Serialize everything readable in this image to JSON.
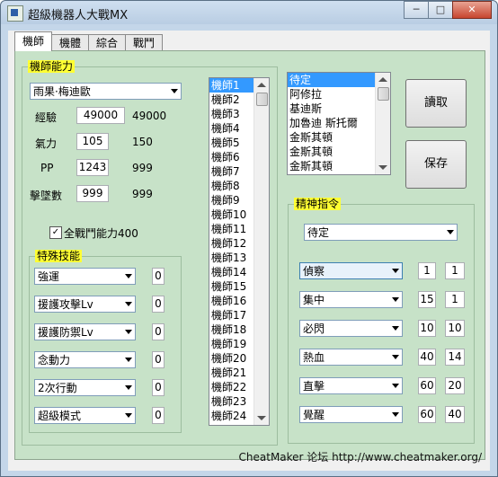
{
  "window": {
    "title": "超級機器人大戰MX",
    "controls": [
      "─",
      "□",
      "✕"
    ]
  },
  "tabs": [
    "機師",
    "機體",
    "綜合",
    "戰鬥"
  ],
  "pilot_group": {
    "legend": "機師能力",
    "pilot_select": "雨果·梅迪歐",
    "stats": [
      {
        "label": "經驗",
        "value": "49000",
        "max": "49000"
      },
      {
        "label": "氣力",
        "value": "105",
        "max": "150"
      },
      {
        "label": "PP",
        "value": "1243",
        "max": "999"
      },
      {
        "label": "擊墜數",
        "value": "999",
        "max": "999"
      }
    ],
    "all_battle_checkbox": {
      "checked": true,
      "mark": "✓",
      "label": "全戰鬥能力400"
    }
  },
  "skills_group": {
    "legend": "特殊技能",
    "skills": [
      {
        "name": "強運",
        "level": "0"
      },
      {
        "name": "援護攻擊Lv",
        "level": "0"
      },
      {
        "name": "援護防禦Lv",
        "level": "0"
      },
      {
        "name": "念動力",
        "level": "0"
      },
      {
        "name": "2次行動",
        "level": "0"
      },
      {
        "name": "超級模式",
        "level": "0"
      }
    ]
  },
  "pilot_list": [
    "機師1",
    "機師2",
    "機師3",
    "機師4",
    "機師5",
    "機師6",
    "機師7",
    "機師8",
    "機師9",
    "機師10",
    "機師11",
    "機師12",
    "機師13",
    "機師14",
    "機師15",
    "機師16",
    "機師17",
    "機師18",
    "機師19",
    "機師20",
    "機師21",
    "機師22",
    "機師23",
    "機師24"
  ],
  "pilot_list_selected": 0,
  "roster_list": [
    "待定",
    "阿修拉",
    "基迪斯",
    "加魯迪 斯托爾",
    "金斯其頓",
    "金斯其頓",
    "金斯其頓"
  ],
  "roster_list_selected": 0,
  "buttons": {
    "load": "讀取",
    "save": "保存"
  },
  "spirit_group": {
    "legend": "精神指令",
    "top_select": "待定",
    "commands": [
      {
        "name": "偵察",
        "level": "1",
        "cost": "1"
      },
      {
        "name": "集中",
        "level": "15",
        "cost": "1"
      },
      {
        "name": "必閃",
        "level": "10",
        "cost": "10"
      },
      {
        "name": "熱血",
        "level": "40",
        "cost": "14"
      },
      {
        "name": "直擊",
        "level": "60",
        "cost": "20"
      },
      {
        "name": "覺醒",
        "level": "60",
        "cost": "40"
      }
    ]
  },
  "footer": "CheatMaker 论坛 http://www.cheatmaker.org/",
  "colors": {
    "panel_bg": "#c7e2c8",
    "legend_bg": "#ffff33",
    "selection": "#3399ff"
  }
}
